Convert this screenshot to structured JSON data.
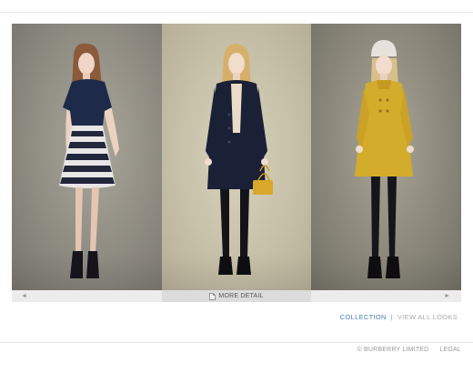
{
  "nav": {
    "prev_arrow": "◄",
    "next_arrow": "►",
    "more_detail": "MORE DETAIL"
  },
  "links": {
    "collection": "COLLECTION",
    "separator": "|",
    "view_all_looks": "VIEW ALL LOOKS"
  },
  "footer": {
    "copyright": "© BURBERRY LIMITED",
    "legal": "LEGAL"
  },
  "looks": [
    {
      "description": "navy top with striped skirt"
    },
    {
      "description": "navy coat with yellow handbag"
    },
    {
      "description": "mustard coat with white beanie"
    }
  ],
  "colors": {
    "accent_link": "#4a7fb6",
    "footer_text": "#999999"
  }
}
